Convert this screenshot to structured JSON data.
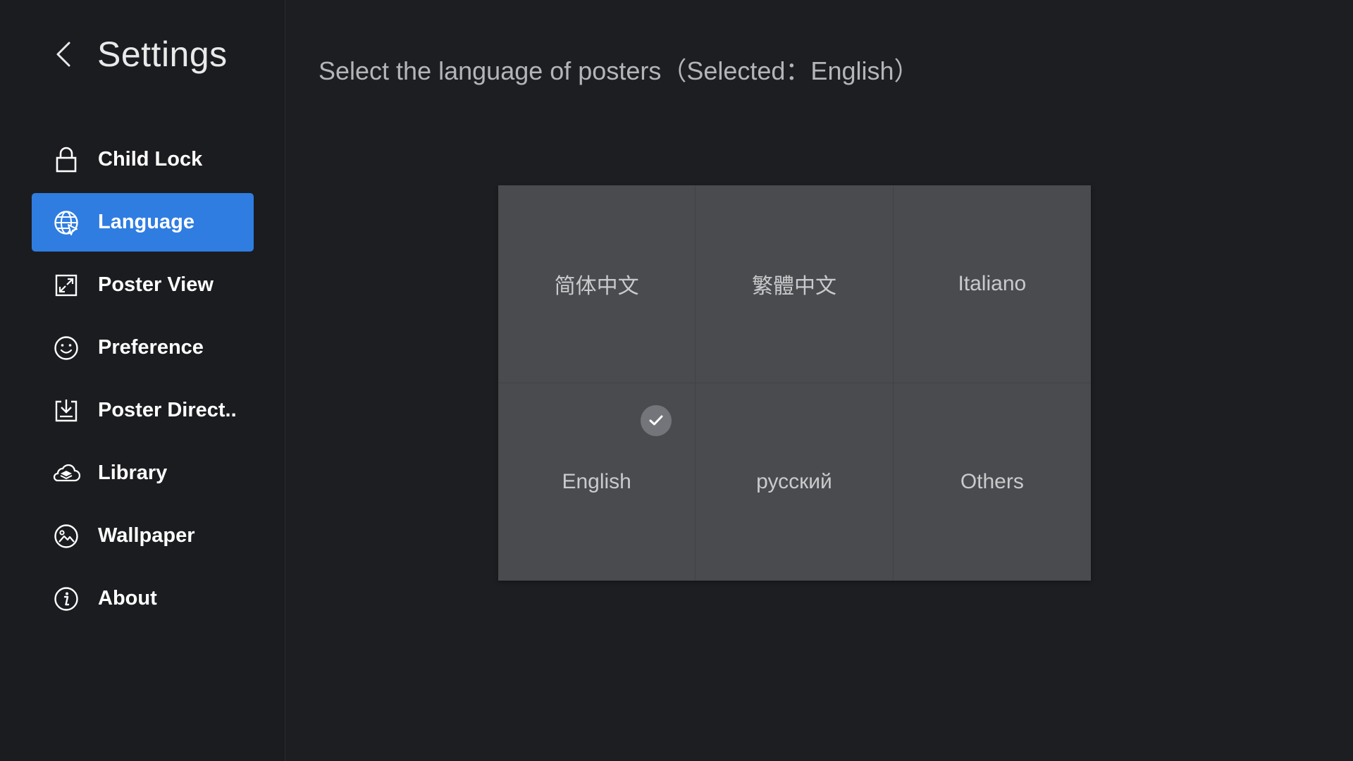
{
  "header": {
    "title": "Settings"
  },
  "sidebar": {
    "items": [
      {
        "label": "Child Lock",
        "icon": "lock-icon",
        "active": false
      },
      {
        "label": "Language",
        "icon": "globe-icon",
        "active": true
      },
      {
        "label": "Poster View",
        "icon": "expand-icon",
        "active": false
      },
      {
        "label": "Preference",
        "icon": "smiley-icon",
        "active": false
      },
      {
        "label": "Poster Direct..",
        "icon": "download-tray-icon",
        "active": false
      },
      {
        "label": "Library",
        "icon": "cloud-layers-icon",
        "active": false
      },
      {
        "label": "Wallpaper",
        "icon": "image-circle-icon",
        "active": false
      },
      {
        "label": "About",
        "icon": "info-icon",
        "active": false
      }
    ]
  },
  "main": {
    "title": "Select the language of posters（Selected：English）",
    "languages": [
      {
        "label": "简体中文",
        "selected": false
      },
      {
        "label": "繁體中文",
        "selected": false
      },
      {
        "label": "Italiano",
        "selected": false
      },
      {
        "label": "English",
        "selected": true
      },
      {
        "label": "русский",
        "selected": false
      },
      {
        "label": "Others",
        "selected": false
      }
    ]
  },
  "colors": {
    "background": "#1d1e21",
    "sidebar": "#1b1c1f",
    "accent": "#2f7de1",
    "tile": "#4a4b4e",
    "check_badge": "#74757a"
  }
}
